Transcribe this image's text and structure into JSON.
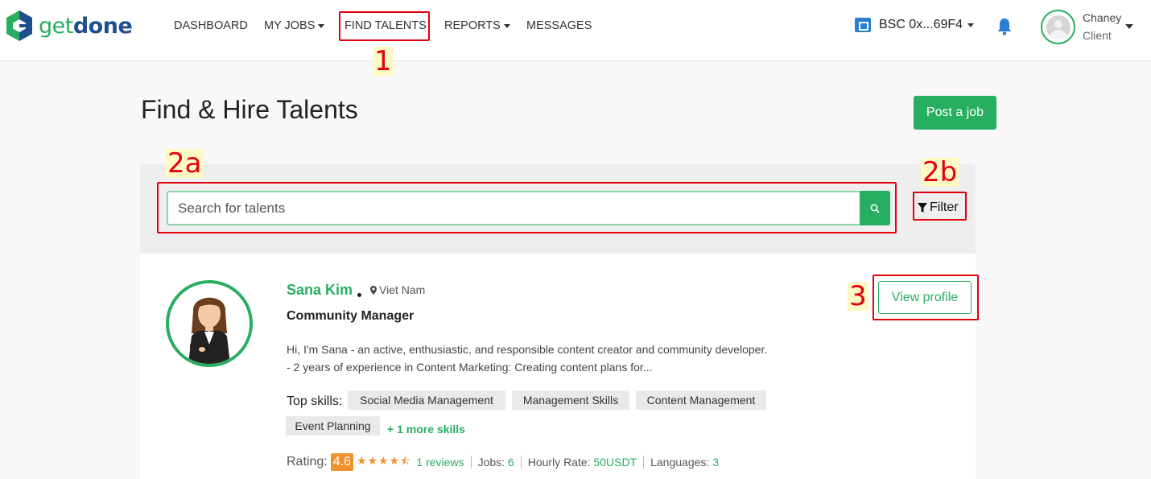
{
  "brand": {
    "get": "get",
    "done": "done"
  },
  "nav": {
    "dashboard": "DASHBOARD",
    "my_jobs": "MY JOBS",
    "find_talents": "FIND TALENTS",
    "reports": "REPORTS",
    "messages": "MESSAGES"
  },
  "wallet": {
    "label": "BSC 0x...69F4"
  },
  "user": {
    "name": "Chaney",
    "role": "Client"
  },
  "page": {
    "title": "Find & Hire Talents",
    "post_job": "Post a job"
  },
  "search": {
    "placeholder": "Search for talents",
    "value": "",
    "filter": "Filter"
  },
  "talent": {
    "name": "Sana Kim",
    "location": "Viet Nam",
    "role": "Community Manager",
    "bio_line1": "Hi, I'm Sana - an active, enthusiastic, and responsible content creator and community developer.",
    "bio_line2": "- 2 years of experience in Content Marketing: Creating content plans for...",
    "skills_label": "Top skills:",
    "skills": [
      "Social Media Management",
      "Management Skills",
      "Content Management",
      "Event Planning"
    ],
    "more_skills": "+ 1 more skills",
    "view_profile": "View profile",
    "rating_label": "Rating:",
    "rating": "4.6",
    "stars": 4.6,
    "reviews": "1 reviews",
    "jobs_label": "Jobs:",
    "jobs": "6",
    "rate_label": "Hourly Rate:",
    "rate": "50USDT",
    "languages_label": "Languages:",
    "languages": "3"
  },
  "annotations": {
    "a1": "1",
    "a2a": "2a",
    "a2b": "2b",
    "a3": "3"
  },
  "colors": {
    "brand_green": "#27ae60",
    "brand_blue": "#1f4f8c",
    "annotation_red": "#e3000f",
    "rating_orange": "#f0912d"
  }
}
